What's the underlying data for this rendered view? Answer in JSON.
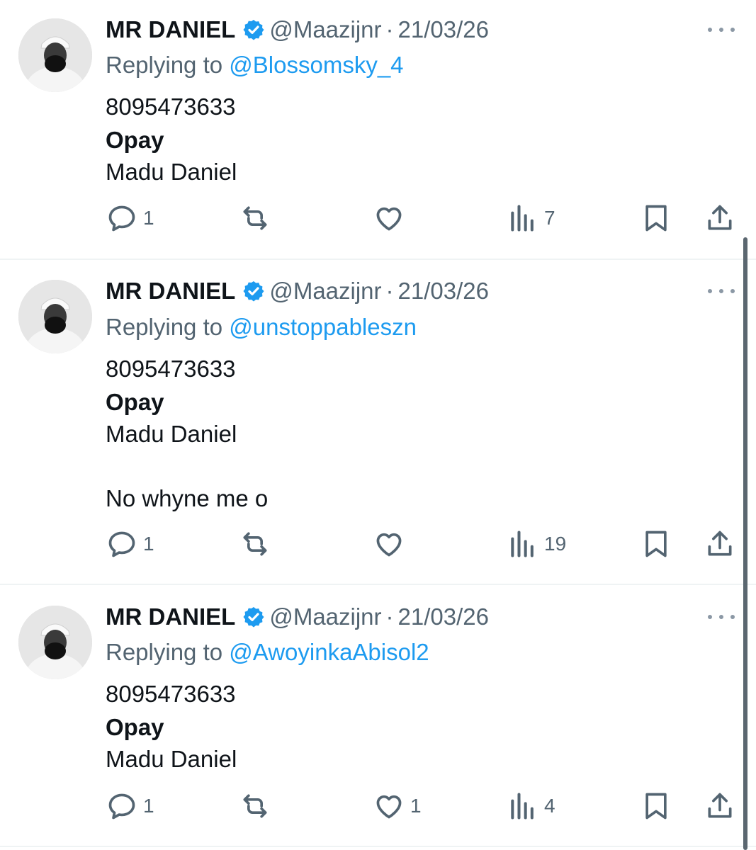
{
  "tweets": [
    {
      "name": "MR DANIEL",
      "handle": "@Maazijnr",
      "separator": "·",
      "date": "21/03/26",
      "reply_prefix": "Replying to",
      "reply_to": "@Blossomsky_4",
      "lines": [
        "8095473633",
        "Opay",
        "Madu Daniel"
      ],
      "extra_line": "",
      "replies": "1",
      "retweets": "",
      "likes": "",
      "views": "7"
    },
    {
      "name": "MR DANIEL",
      "handle": "@Maazijnr",
      "separator": "·",
      "date": "21/03/26",
      "reply_prefix": "Replying to",
      "reply_to": "@unstoppableszn",
      "lines": [
        "8095473633",
        "Opay",
        "Madu Daniel"
      ],
      "extra_line": "No whyne me o",
      "replies": "1",
      "retweets": "",
      "likes": "",
      "views": "19"
    },
    {
      "name": "MR DANIEL",
      "handle": "@Maazijnr",
      "separator": "·",
      "date": "21/03/26",
      "reply_prefix": "Replying to",
      "reply_to": "@AwoyinkaAbisol2",
      "lines": [
        "8095473633",
        "Opay",
        "Madu Daniel"
      ],
      "extra_line": "",
      "replies": "1",
      "retweets": "",
      "likes": "1",
      "views": "4"
    }
  ],
  "icons": {
    "verified": "verified-badge-icon",
    "more": "more-dots-icon",
    "reply": "reply-bubble-icon",
    "retweet": "retweet-icon",
    "like": "heart-icon",
    "views": "bar-chart-icon",
    "bookmark": "bookmark-icon",
    "share": "share-upload-icon"
  },
  "colors": {
    "text": "#0f1419",
    "secondary": "#536471",
    "link": "#1d9bf0",
    "verified": "#1d9bf0",
    "divider": "#eff3f4"
  }
}
